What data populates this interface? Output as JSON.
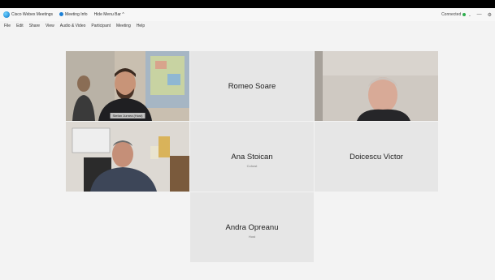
{
  "titlebar": {
    "app_name": "Cisco Webex Meetings",
    "meeting_info": "Meeting Info",
    "menu_bar_toggle": "Hide Menu Bar ^",
    "status": "Connected",
    "minimize": "—",
    "settings": "⚙"
  },
  "menubar": [
    "File",
    "Edit",
    "Share",
    "View",
    "Audio & Video",
    "Participant",
    "Meeting",
    "Help"
  ],
  "participants": [
    {
      "name": "Stefan Jurnea",
      "role": "Host",
      "video": true
    },
    {
      "name": "Romeo Soare",
      "role": "",
      "video": false
    },
    {
      "name": "",
      "role": "",
      "video": true
    },
    {
      "name": "",
      "role": "",
      "video": true
    },
    {
      "name": "Ana Stoican",
      "role": "Cohost",
      "video": false
    },
    {
      "name": "Doicescu Victor",
      "role": "",
      "video": false
    },
    {
      "name": "Andra Opreanu",
      "role": "Host",
      "video": false
    }
  ],
  "colors": {
    "selected_outline": "#31b3dc",
    "connected": "#2fae4e",
    "tile_bg": "#e6e6e6"
  }
}
